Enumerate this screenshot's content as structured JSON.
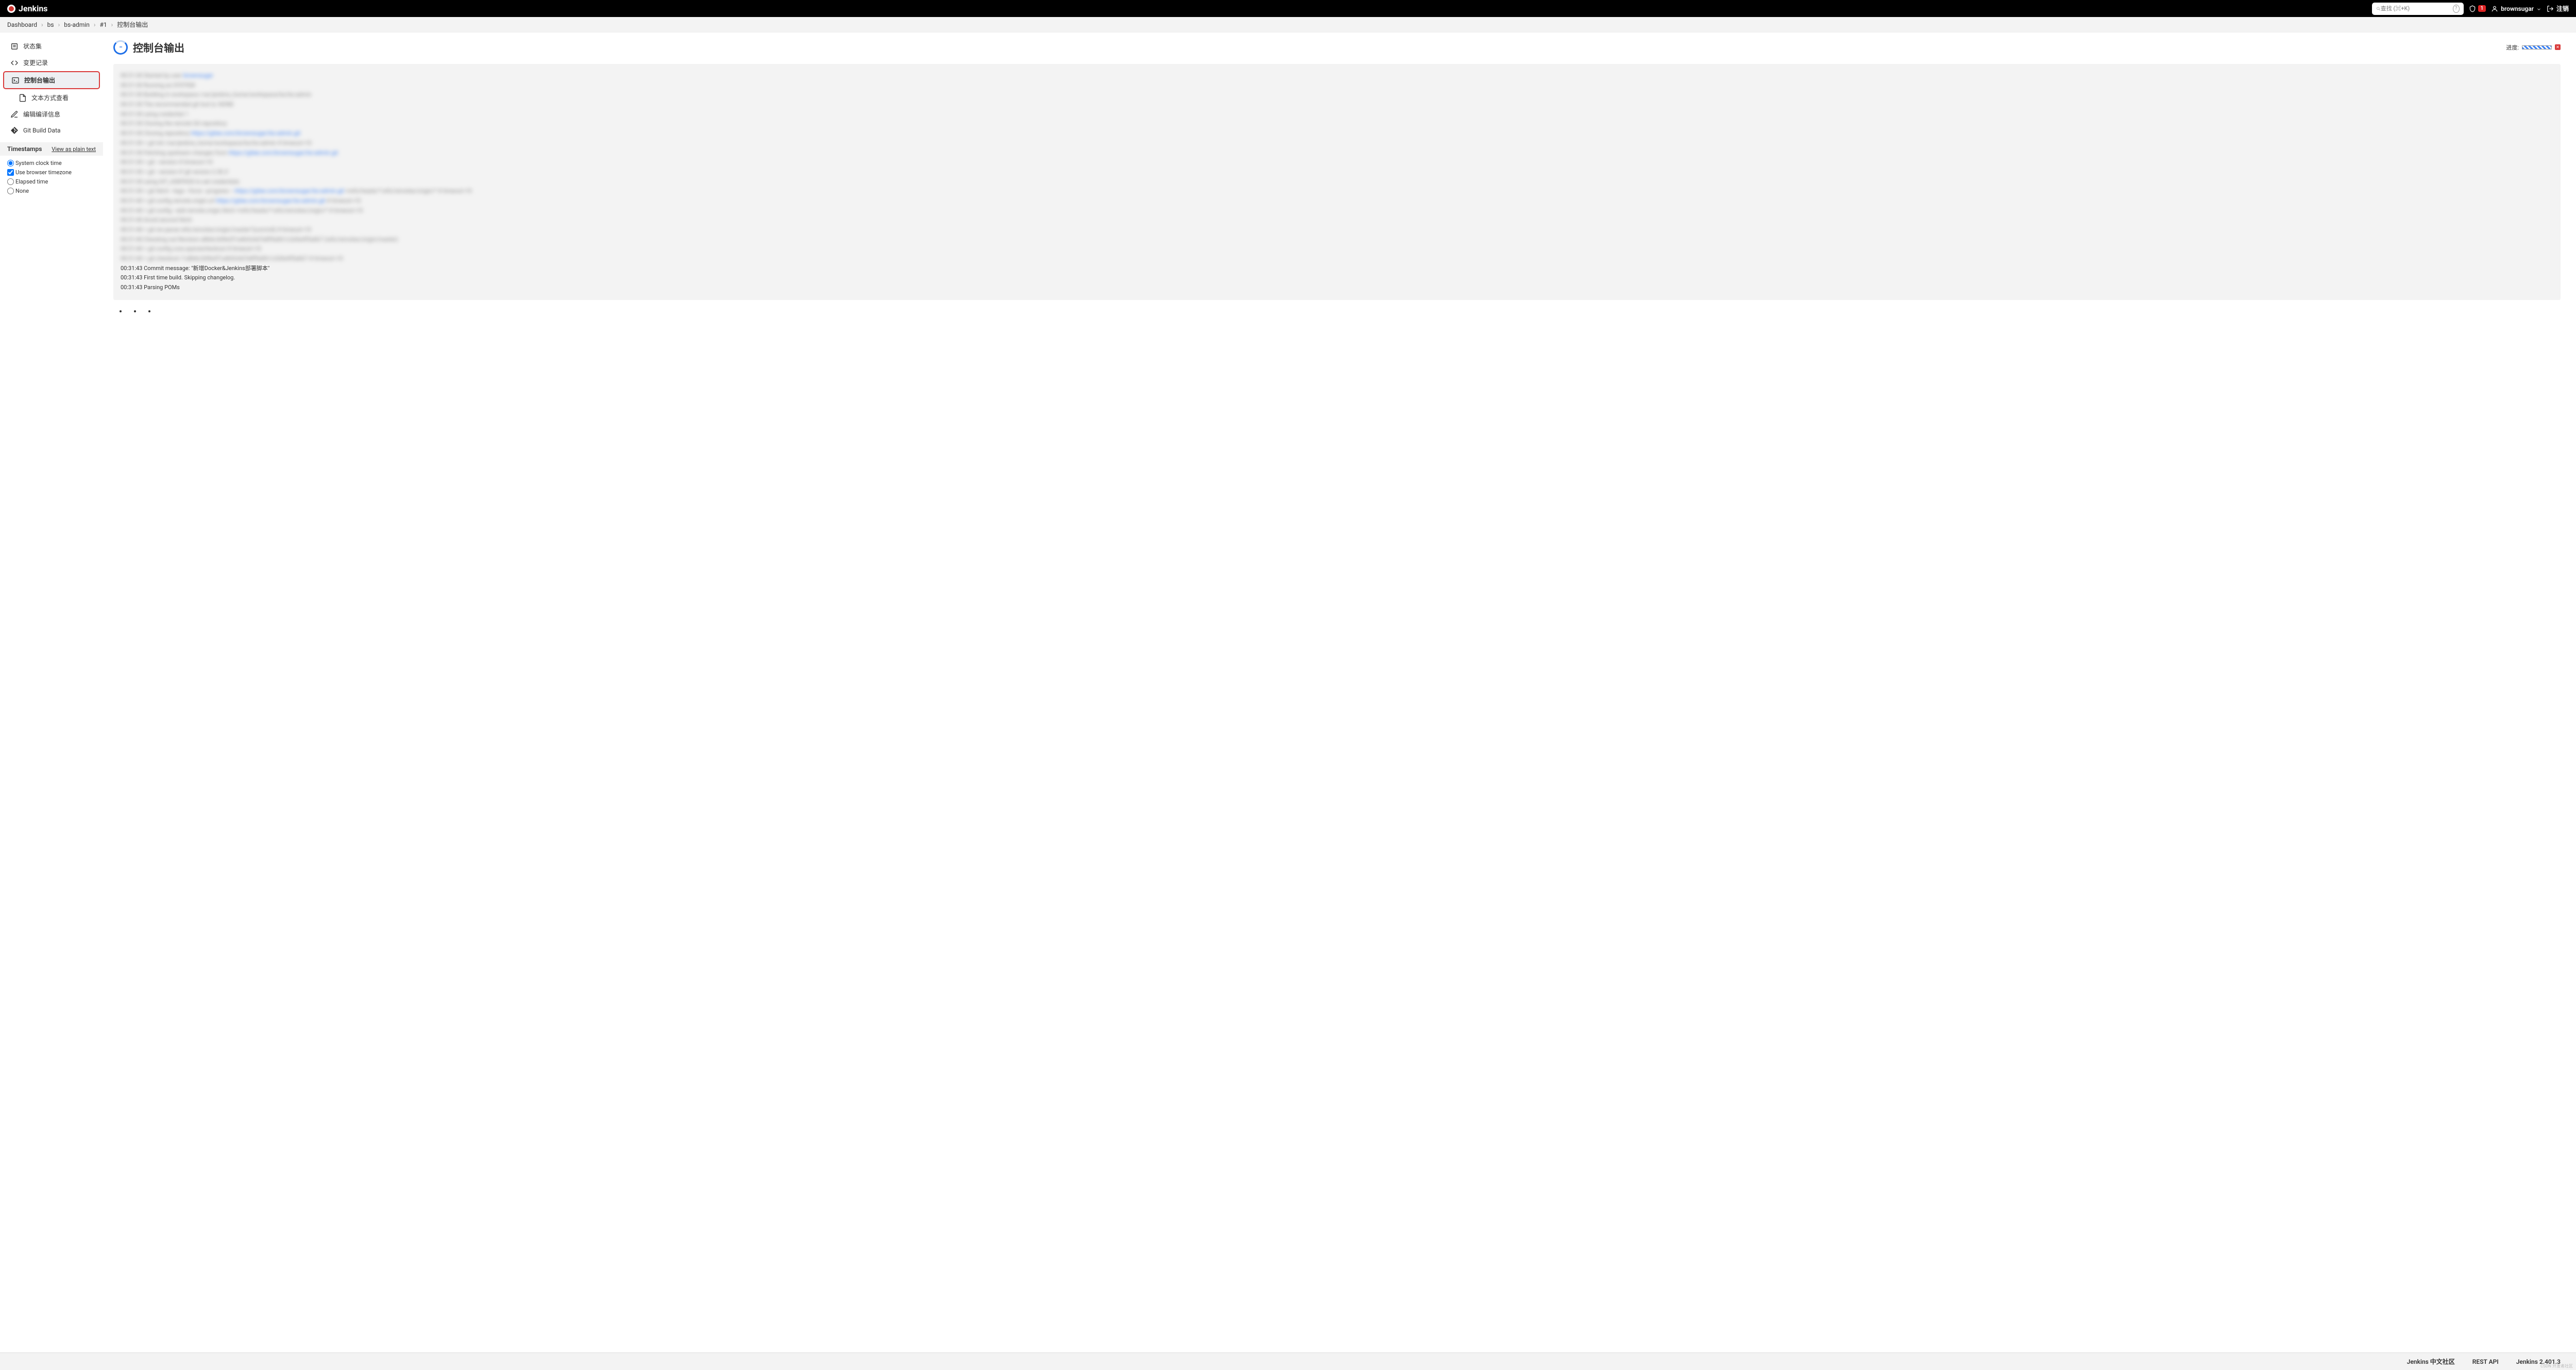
{
  "header": {
    "brand": "Jenkins",
    "search_placeholder": "查找 (⌘+K)",
    "alert_count": "1",
    "username": "brownsugar",
    "logout": "注销"
  },
  "breadcrumb": [
    {
      "label": "Dashboard"
    },
    {
      "label": "bs"
    },
    {
      "label": "bs-admin"
    },
    {
      "label": "#1"
    },
    {
      "label": "控制台输出"
    }
  ],
  "sidebar": {
    "items": [
      {
        "label": "状态集"
      },
      {
        "label": "变更记录"
      },
      {
        "label": "控制台输出"
      },
      {
        "label": "文本方式查看"
      },
      {
        "label": "编辑编译信息"
      },
      {
        "label": "Git Build Data"
      }
    ],
    "timestamps": {
      "title": "Timestamps",
      "plain_text_link": "View as plain text",
      "options": [
        {
          "id": "system-clock",
          "label": "System clock time",
          "type": "radio",
          "checked": true
        },
        {
          "id": "browser-tz",
          "label": "Use browser timezone",
          "type": "checkbox",
          "checked": true
        },
        {
          "id": "elapsed",
          "label": "Elapsed time",
          "type": "radio",
          "checked": false
        },
        {
          "id": "none",
          "label": "None",
          "type": "radio",
          "checked": false
        }
      ]
    }
  },
  "page": {
    "title": "控制台输出",
    "progress_label": "进度:"
  },
  "console": {
    "line1": "00:31:43 Commit message: \"新增Docker&Jenkins部署脚本\"",
    "line2": "00:31:43 First time build. Skipping changelog.",
    "line3": "00:31:43 Parsing POMs"
  },
  "footer": {
    "community": "Jenkins 中文社区",
    "rest_api": "REST API",
    "version": "Jenkins 2.401.3"
  },
  "watermark": "CSDN 开发者社区"
}
